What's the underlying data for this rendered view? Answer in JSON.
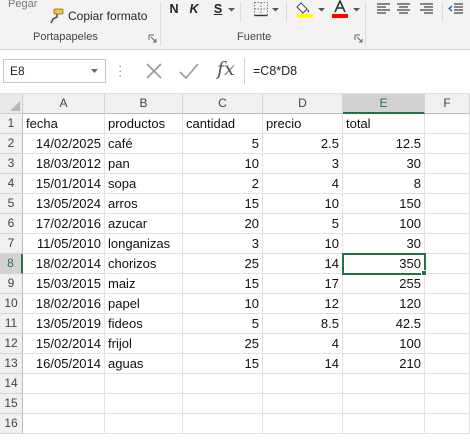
{
  "ribbon": {
    "paste_label": "Pegar",
    "copy_format_label": "Copiar formato",
    "clipboard_group": "Portapapeles",
    "font_group": "Fuente",
    "bold": "N",
    "italic": "K",
    "underline": "S",
    "fill_color": "#ffff00",
    "font_color": "#ff0000"
  },
  "formula_bar": {
    "name_box": "E8",
    "fx_label": "fx",
    "formula": "=C8*D8"
  },
  "sheet": {
    "columns": [
      "A",
      "B",
      "C",
      "D",
      "E",
      "F"
    ],
    "row_numbers": [
      "1",
      "2",
      "3",
      "4",
      "5",
      "6",
      "7",
      "8",
      "9",
      "10",
      "11",
      "12",
      "13",
      "14",
      "15",
      "16"
    ],
    "headers": [
      "fecha",
      "productos",
      "cantidad",
      "precio",
      "total"
    ],
    "rows": [
      [
        "14/02/2025",
        "café",
        "5",
        "2.5",
        "12.5"
      ],
      [
        "18/03/2012",
        "pan",
        "10",
        "3",
        "30"
      ],
      [
        "15/01/2014",
        "sopa",
        "2",
        "4",
        "8"
      ],
      [
        "13/05/2024",
        "arros",
        "15",
        "10",
        "150"
      ],
      [
        "17/02/2016",
        "azucar",
        "20",
        "5",
        "100"
      ],
      [
        "11/05/2010",
        "longanizas",
        "3",
        "10",
        "30"
      ],
      [
        "18/02/2014",
        "chorizos",
        "25",
        "14",
        "350"
      ],
      [
        "15/03/2015",
        "maiz",
        "15",
        "17",
        "255"
      ],
      [
        "18/02/2016",
        "papel",
        "10",
        "12",
        "120"
      ],
      [
        "13/05/2019",
        "fideos",
        "5",
        "8.5",
        "42.5"
      ],
      [
        "15/02/2014",
        "frijol",
        "25",
        "4",
        "100"
      ],
      [
        "16/05/2014",
        "aguas",
        "15",
        "14",
        "210"
      ]
    ],
    "active_cell": "E8",
    "accent_color": "#217346"
  }
}
